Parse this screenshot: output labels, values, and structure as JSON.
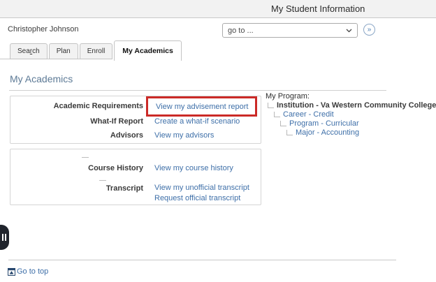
{
  "title_bar": {
    "title": "My Student Information"
  },
  "user_bar": {
    "name": "Christopher Johnson",
    "goto_placeholder": "go to ...",
    "go_icon": "»"
  },
  "tabs": {
    "search_pre": "Sea",
    "search_key": "r",
    "search_post": "ch",
    "plan": "Plan",
    "enroll": "Enroll",
    "my_academics": "My Academics"
  },
  "content": {
    "heading": "My Academics",
    "academics_box": {
      "rows": [
        {
          "label": "Academic Requirements",
          "link": "View my advisement report"
        },
        {
          "label": "What-If Report",
          "link": "Create a what-if scenario"
        },
        {
          "label": "Advisors",
          "link": "View my advisors"
        }
      ]
    },
    "history_box": {
      "course_history_label": "Course History",
      "course_history_link": "View my course history",
      "transcript_label": "Transcript",
      "transcript_link_1": "View my unofficial transcript",
      "transcript_link_2": "Request official transcript"
    },
    "my_program": {
      "heading": "My Program:",
      "institution": "Institution - Va Western Community College",
      "career": "Career - Credit",
      "program": "Program - Curricular",
      "major": "Major - Accounting"
    }
  },
  "footer": {
    "go_to_top": "Go to top"
  },
  "colors": {
    "link_blue": "#3e6fa8",
    "highlight_red": "#cb2a27",
    "heading_blue": "#5d7a96"
  }
}
